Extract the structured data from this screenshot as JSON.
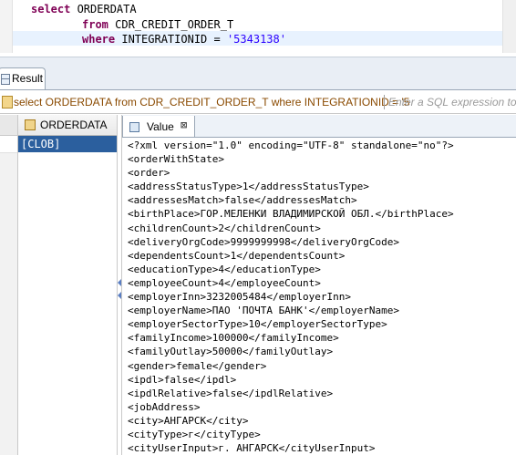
{
  "editor": {
    "lines": [
      {
        "kw": "select",
        "rest": " ORDERDATA"
      },
      {
        "kw": "from",
        "rest": " CDR_CREDIT_ORDER_T"
      },
      {
        "kw": "where",
        "rest": " INTEGRATIONID = ",
        "str": "'5343138'"
      }
    ]
  },
  "results_tab": {
    "label": "Result"
  },
  "query_bar": {
    "sql": "select ORDERDATA from CDR_CREDIT_ORDER_T where INTEGRATIONID = '5",
    "filter_placeholder": "Enter a SQL expression to f"
  },
  "grid": {
    "column_header": "ORDERDATA",
    "rows": [
      "[CLOB]"
    ]
  },
  "value_panel": {
    "tab_label": "Value",
    "close_glyph": "⊠",
    "lines": [
      "<?xml version=\"1.0\" encoding=\"UTF-8\" standalone=\"no\"?>",
      "<orderWithState>",
      "<order>",
      "<addressStatusType>1</addressStatusType>",
      "<addressesMatch>false</addressesMatch>",
      "<birthPlace>ГОР.МЕЛЕНКИ ВЛАДИМИРСКОЙ ОБЛ.</birthPlace>",
      "<childrenCount>2</childrenCount>",
      "<deliveryOrgCode>9999999998</deliveryOrgCode>",
      "<dependentsCount>1</dependentsCount>",
      "<educationType>4</educationType>",
      "<employeeCount>4</employeeCount>",
      "<employerInn>3232005484</employerInn>",
      "<employerName>ПАО 'ПОЧТА БАНК'</employerName>",
      "<employerSectorType>10</employerSectorType>",
      "<familyIncome>100000</familyIncome>",
      "<familyOutlay>50000</familyOutlay>",
      "<gender>female</gender>",
      "<ipdl>false</ipdl>",
      "<ipdlRelative>false</ipdlRelative>",
      "<jobAddress>",
      "<city>АНГАРСК</city>",
      "<cityType>г</cityType>",
      "<cityUserInput>г. АНГАРСК</cityUserInput>"
    ]
  }
}
